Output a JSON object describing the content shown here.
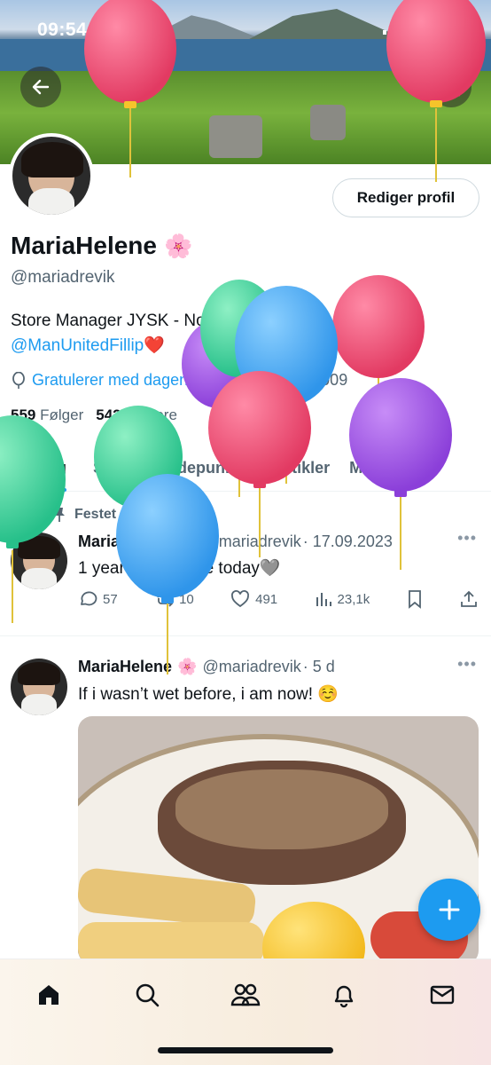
{
  "status_bar": {
    "time": "09:54"
  },
  "profile": {
    "name": "MariaHelene",
    "name_emoji": "🌸",
    "handle": "@mariadrevik",
    "edit_label": "Rediger profil",
    "bio_line1": "Store Manager JYSK - Norway 🇳🇴⚽️",
    "bio_link": "@ManUnitedFillip",
    "bio_heart": "❤️",
    "birthday_text": "Gratulerer med dagen!",
    "joined_text": "Ble med i april 2009",
    "followers_count": "559",
    "followers_label": "Følger",
    "following_count": "542",
    "following_label": "Følgere"
  },
  "tabs": [
    {
      "label": "Innlegg",
      "active": true
    },
    {
      "label": "Svar"
    },
    {
      "label": "Høydepunkter"
    },
    {
      "label": "Artikler"
    },
    {
      "label": "Medier"
    }
  ],
  "pinned_label": "Festet",
  "posts": [
    {
      "name": "MariaHelene",
      "emoji": "🌸",
      "handle": "@mariadrevik",
      "date": "· 17.09.2023",
      "text": "1 year cancer free today🩶",
      "replies": "57",
      "reposts": "10",
      "likes": "491",
      "views": "23,1k"
    },
    {
      "name": "MariaHelene",
      "emoji": "🌸",
      "handle": "@mariadrevik",
      "date": "· 5 d",
      "text": "If i wasn’t wet before, i am now! ☺️"
    }
  ],
  "icons": {
    "back": "arrow-left-icon",
    "search": "search-icon",
    "birthday": "balloon-icon",
    "pin": "pin-icon",
    "reply": "reply-icon",
    "repost": "repost-icon",
    "like": "heart-icon",
    "views": "views-icon",
    "bookmark": "bookmark-icon",
    "share": "share-icon",
    "compose": "plus-icon",
    "nav": [
      "home-icon",
      "search-icon",
      "communities-icon",
      "notifications-icon",
      "messages-icon"
    ]
  },
  "colors": {
    "accent": "#1d9bf0",
    "text": "#0f1419",
    "secondary": "#536471",
    "balloon_pink": "#ef4a6f",
    "balloon_green": "#3ecf9a",
    "balloon_blue": "#3fa3f0",
    "balloon_purple": "#9d4fe0",
    "balloon_yellow": "#f6c42b"
  }
}
